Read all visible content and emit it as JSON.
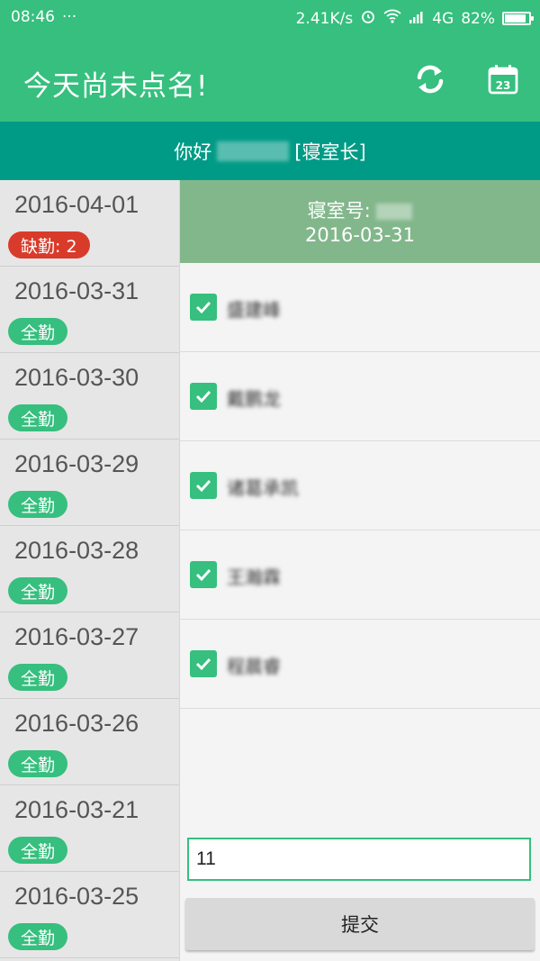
{
  "statusbar": {
    "time": "08:46",
    "dots": "···",
    "speed": "2.41K/s",
    "network": "4G",
    "battery": "82%"
  },
  "appbar": {
    "title": "今天尚未点名!",
    "refresh_icon": "refresh-icon",
    "calendar_icon": "calendar-icon",
    "calendar_day": "23"
  },
  "greeting": {
    "prefix": "你好",
    "role": "[寝室长]"
  },
  "room": {
    "label": "寝室号:",
    "date": "2016-03-31"
  },
  "dates": [
    {
      "date": "2016-04-01",
      "status": "缺勤: 2",
      "type": "absent"
    },
    {
      "date": "2016-03-31",
      "status": "全勤",
      "type": "full"
    },
    {
      "date": "2016-03-30",
      "status": "全勤",
      "type": "full"
    },
    {
      "date": "2016-03-29",
      "status": "全勤",
      "type": "full"
    },
    {
      "date": "2016-03-28",
      "status": "全勤",
      "type": "full"
    },
    {
      "date": "2016-03-27",
      "status": "全勤",
      "type": "full"
    },
    {
      "date": "2016-03-26",
      "status": "全勤",
      "type": "full"
    },
    {
      "date": "2016-03-21",
      "status": "全勤",
      "type": "full"
    },
    {
      "date": "2016-03-25",
      "status": "全勤",
      "type": "full"
    }
  ],
  "members": [
    {
      "name": "盛建峰",
      "checked": true
    },
    {
      "name": "戴鹏龙",
      "checked": true
    },
    {
      "name": "诸葛承凯",
      "checked": true
    },
    {
      "name": "王瀚霖",
      "checked": true
    },
    {
      "name": "程晨睿",
      "checked": true
    }
  ],
  "input": {
    "value": "11"
  },
  "submit": {
    "label": "提交"
  },
  "colors": {
    "primary": "#36bf7e",
    "teal": "#009b86",
    "absent": "#d93b2b",
    "room_head": "#82b78b"
  }
}
